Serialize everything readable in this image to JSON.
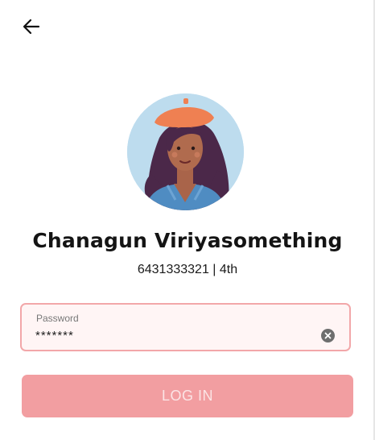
{
  "header": {
    "back_icon": "arrow-left-icon"
  },
  "profile": {
    "avatar_icon": "user-avatar-illustration",
    "name": "Chanagun Viriyasomething",
    "meta": "6431333321 | 4th"
  },
  "password": {
    "label": "Password",
    "value": "*******",
    "clear_icon": "clear-circle-icon"
  },
  "login": {
    "label": "LOG IN"
  },
  "colors": {
    "accent": "#f29ea1",
    "field_border": "#f2a7a9",
    "field_background": "#fff5f5",
    "avatar_background": "#bddcee"
  }
}
